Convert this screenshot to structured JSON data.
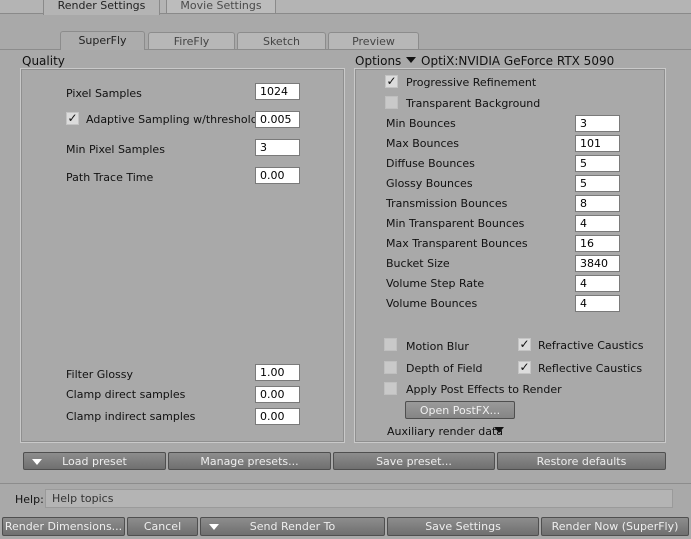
{
  "top_tabs": [
    "Render Settings",
    "Movie Settings"
  ],
  "sub_tabs": [
    "SuperFly",
    "FireFly",
    "Sketch",
    "Preview"
  ],
  "quality": {
    "title": "Quality",
    "pixel_samples_label": "Pixel Samples",
    "pixel_samples": "1024",
    "adaptive_label": "Adaptive Sampling w/threshold:",
    "adaptive_checked": true,
    "adaptive_value": "0.005",
    "min_pixel_label": "Min Pixel Samples",
    "min_pixel": "3",
    "path_trace_label": "Path Trace Time",
    "path_trace": "0.00",
    "filter_glossy_label": "Filter Glossy",
    "filter_glossy": "1.00",
    "clamp_direct_label": "Clamp direct samples",
    "clamp_direct": "0.00",
    "clamp_indirect_label": "Clamp indirect samples",
    "clamp_indirect": "0.00"
  },
  "options": {
    "title": "Options",
    "device": "OptiX:NVIDIA GeForce RTX 5090",
    "progressive_label": "Progressive Refinement",
    "progressive_checked": true,
    "transparent_label": "Transparent Background",
    "transparent_checked": false,
    "bounces": [
      {
        "label": "Min Bounces",
        "value": "3"
      },
      {
        "label": "Max Bounces",
        "value": "101"
      },
      {
        "label": "Diffuse Bounces",
        "value": "5"
      },
      {
        "label": "Glossy Bounces",
        "value": "5"
      },
      {
        "label": "Transmission Bounces",
        "value": "8"
      },
      {
        "label": "Min Transparent Bounces",
        "value": "4"
      },
      {
        "label": "Max Transparent Bounces",
        "value": "16"
      },
      {
        "label": "Bucket Size",
        "value": "3840"
      },
      {
        "label": "Volume Step Rate",
        "value": "4"
      },
      {
        "label": "Volume Bounces",
        "value": "4"
      }
    ],
    "motion_blur_label": "Motion Blur",
    "motion_blur_checked": false,
    "refractive_label": "Refractive Caustics",
    "refractive_checked": true,
    "depth_of_field_label": "Depth of Field",
    "depth_of_field_checked": false,
    "reflective_label": "Reflective Caustics",
    "reflective_checked": true,
    "post_effects_label": "Apply Post Effects to Render",
    "post_effects_checked": false,
    "open_postfx_label": "Open PostFX...",
    "aux_label": "Auxiliary render data"
  },
  "preset_bar": {
    "load": "Load preset",
    "manage": "Manage presets...",
    "save": "Save preset...",
    "restore": "Restore defaults"
  },
  "help": {
    "label": "Help:",
    "text": "Help topics"
  },
  "bottom_bar": {
    "dimensions": "Render Dimensions...",
    "cancel": "Cancel",
    "send": "Send Render To",
    "save_settings": "Save Settings",
    "render_now": "Render Now (SuperFly)"
  }
}
